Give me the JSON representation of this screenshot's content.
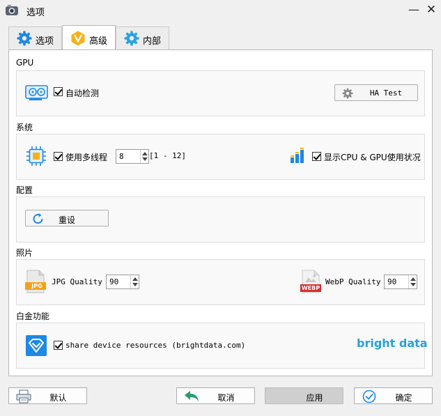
{
  "window": {
    "title": "选项"
  },
  "tabs": [
    {
      "label": "选项"
    },
    {
      "label": "高级"
    },
    {
      "label": "内部"
    }
  ],
  "sections": {
    "gpu": {
      "title": "GPU",
      "auto_detect_label": "自动检测",
      "auto_detect_checked": true,
      "ha_test_label": "HA Test"
    },
    "system": {
      "title": "系统",
      "multithread_label": "使用多线程",
      "multithread_checked": true,
      "threads_value": "8",
      "threads_range": "[1 - 12]",
      "show_usage_label": "显示CPU & GPU使用状况",
      "show_usage_checked": true
    },
    "config": {
      "title": "配置",
      "reset_label": "重设"
    },
    "photo": {
      "title": "照片",
      "jpg_label": "JPG Quality",
      "jpg_value": "90",
      "jpg_icon_text": "JPG",
      "webp_label": "WebP Quality",
      "webp_value": "90",
      "webp_icon_text": "WEBP"
    },
    "platinum": {
      "title": "白金功能",
      "share_label": "share device resources (brightdata.com)",
      "share_checked": true,
      "brand": "bright data"
    }
  },
  "footer": {
    "default_label": "默认",
    "cancel_label": "取消",
    "apply_label": "应用",
    "ok_label": "确定"
  },
  "colors": {
    "accent_blue": "#1e88e5",
    "brand_blue": "#2aa0d8",
    "tab_orange": "#f5b21a",
    "cancel_green": "#2e9a6f"
  }
}
